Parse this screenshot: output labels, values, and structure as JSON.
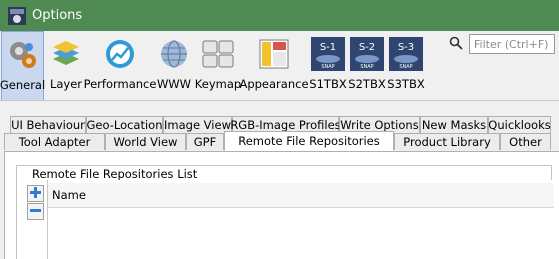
{
  "window": {
    "title": "Options"
  },
  "toolbar": {
    "items": [
      {
        "label": "General",
        "icon": "gear-icon",
        "active": true
      },
      {
        "label": "Layer",
        "icon": "layer-icon"
      },
      {
        "label": "Performance",
        "icon": "performance-icon"
      },
      {
        "label": "WWW",
        "icon": "globe-icon"
      },
      {
        "label": "Keymap",
        "icon": "keyboard-icon"
      },
      {
        "label": "Appearance",
        "icon": "appearance-icon"
      },
      {
        "label": "S1TBX",
        "icon": "s1-icon",
        "badge": "S-1"
      },
      {
        "label": "S2TBX",
        "icon": "s2-icon",
        "badge": "S-2"
      },
      {
        "label": "S3TBX",
        "icon": "s3-icon",
        "badge": "S-3"
      }
    ],
    "badge_brand": "SNAP"
  },
  "search": {
    "placeholder": "Filter (Ctrl+F)",
    "value": ""
  },
  "tabs": {
    "row1": [
      "UI Behaviour",
      "Geo-Location",
      "Image View",
      "RGB-Image Profiles",
      "Write Options",
      "New Masks",
      "Quicklooks"
    ],
    "row2": [
      "Tool Adapter",
      "World View",
      "GPF",
      "Remote File Repositories",
      "Product Library",
      "Other"
    ],
    "selected": "Remote File Repositories"
  },
  "panel": {
    "group_title": "Remote File Repositories List",
    "add_icon": "plus-icon",
    "remove_icon": "minus-icon",
    "column_header": "Name"
  },
  "colors": {
    "titlebar": "#4e8a52",
    "active_tool": "#c9d8ee",
    "button_blue": "#2e7bd6"
  }
}
